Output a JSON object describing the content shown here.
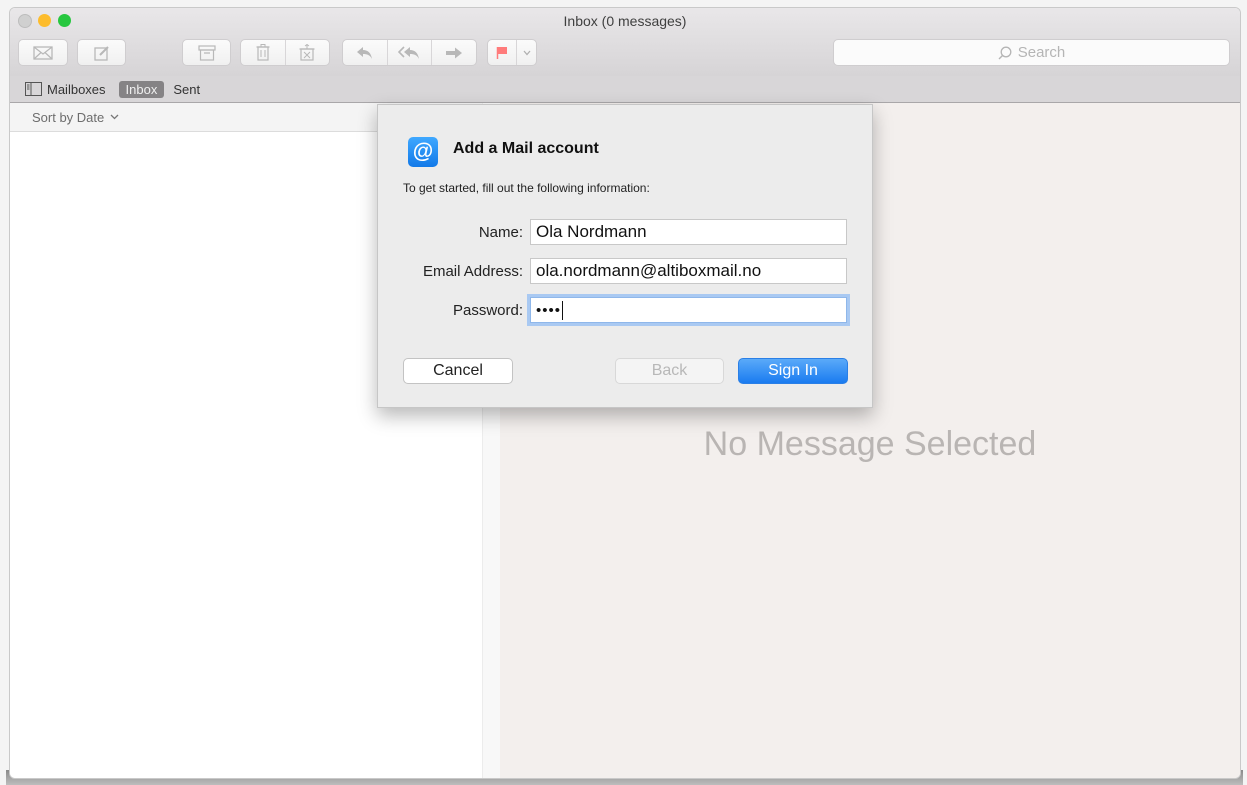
{
  "window": {
    "title": "Inbox (0 messages)"
  },
  "toolbar": {
    "get_mail_icon": "envelope-icon",
    "compose_icon": "compose-icon",
    "archive_icon": "archive-box-icon",
    "delete_icon": "trash-icon",
    "junk_icon": "junk-icon",
    "reply_icon": "reply-arrow-icon",
    "reply_all_icon": "reply-all-arrow-icon",
    "forward_icon": "forward-arrow-icon",
    "flag_icon": "flag-icon",
    "flag_color": "#ff6b6b",
    "search_placeholder": "Search"
  },
  "favorites": {
    "items": [
      {
        "label": "Mailboxes",
        "active": false
      },
      {
        "label": "Inbox",
        "active": true
      },
      {
        "label": "Sent",
        "active": false
      }
    ]
  },
  "message_list": {
    "sort_label": "Sort by Date"
  },
  "viewer": {
    "empty_text": "No Message Selected"
  },
  "dialog": {
    "title": "Add a Mail account",
    "subtitle": "To get started, fill out the following information:",
    "fields": [
      {
        "label": "Name:",
        "value": "Ola Nordmann"
      },
      {
        "label": "Email Address:",
        "value": "ola.nordmann@altiboxmail.no"
      },
      {
        "label": "Password:",
        "value": "••••"
      }
    ],
    "buttons": {
      "cancel": "Cancel",
      "back": "Back",
      "sign_in": "Sign In"
    },
    "accent_color": "#1a7bf0"
  }
}
